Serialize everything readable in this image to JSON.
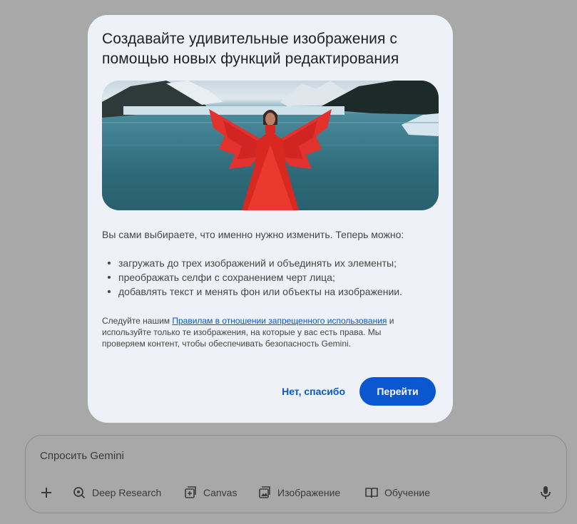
{
  "dialog": {
    "title": "Создавайте удивительные изображения с помощью новых функций редактирования",
    "intro": "Вы сами выбираете, что именно нужно изменить. Теперь можно:",
    "bullets": [
      "загружать до трех изображений и объединять их элементы;",
      "преображать селфи с сохранением черт лица;",
      "добавлять текст и менять фон или объекты на изображении."
    ],
    "policy_prefix": "Следуйте нашим ",
    "policy_link": "Правилам в отношении запрещенного использования",
    "policy_suffix": " и используйте только те изображения, на которые у вас есть права. Мы проверяем контент, чтобы обеспечивать безопасность Gemini.",
    "secondary_button": "Нет, спасибо",
    "primary_button": "Перейти"
  },
  "prompt": {
    "placeholder": "Спросить Gemini",
    "tools": [
      {
        "label": "Deep Research",
        "icon": "deep-research-icon"
      },
      {
        "label": "Canvas",
        "icon": "canvas-icon"
      },
      {
        "label": "Изображение",
        "icon": "image-icon"
      },
      {
        "label": "Обучение",
        "icon": "book-icon"
      }
    ],
    "icons": {
      "add": "plus-icon",
      "mic": "mic-icon"
    }
  },
  "colors": {
    "accent": "#0b57d0",
    "dialog_bg": "#eef2f8",
    "scrim": "#a8a8a8"
  }
}
